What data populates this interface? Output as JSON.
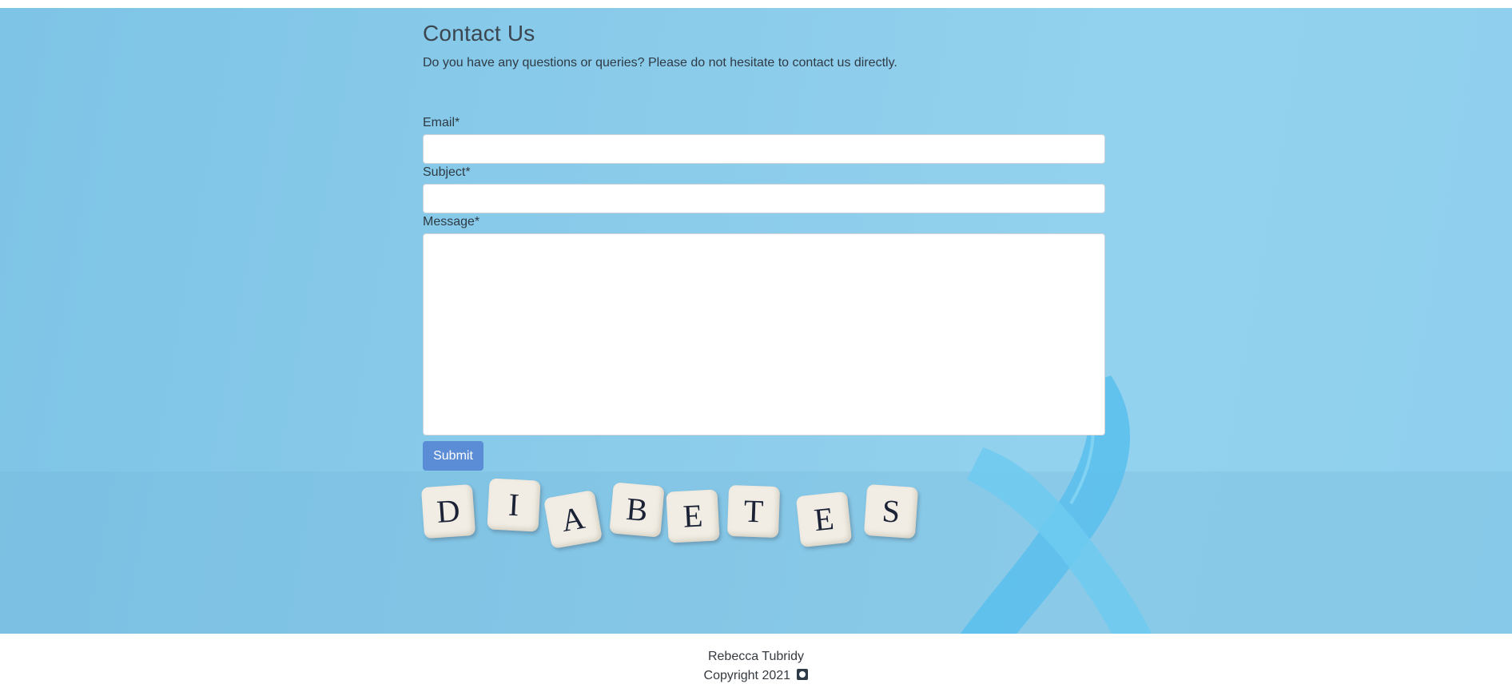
{
  "page": {
    "title": "Contact Us",
    "intro": "Do you have any questions or queries? Please do not hesitate to contact us directly."
  },
  "form": {
    "email_label": "Email*",
    "email_value": "",
    "subject_label": "Subject*",
    "subject_value": "",
    "message_label": "Message*",
    "message_value": "",
    "submit_label": "Submit"
  },
  "dice_letters": [
    "D",
    "I",
    "A",
    "B",
    "E",
    "T",
    "E",
    "S"
  ],
  "footer": {
    "author": "Rebecca Tubridy",
    "copyright": "Copyright 2021",
    "icon": "github-icon"
  },
  "colors": {
    "background": "#8acbea",
    "button": "#5b8dd6",
    "ribbon": "#4fb6e8"
  }
}
